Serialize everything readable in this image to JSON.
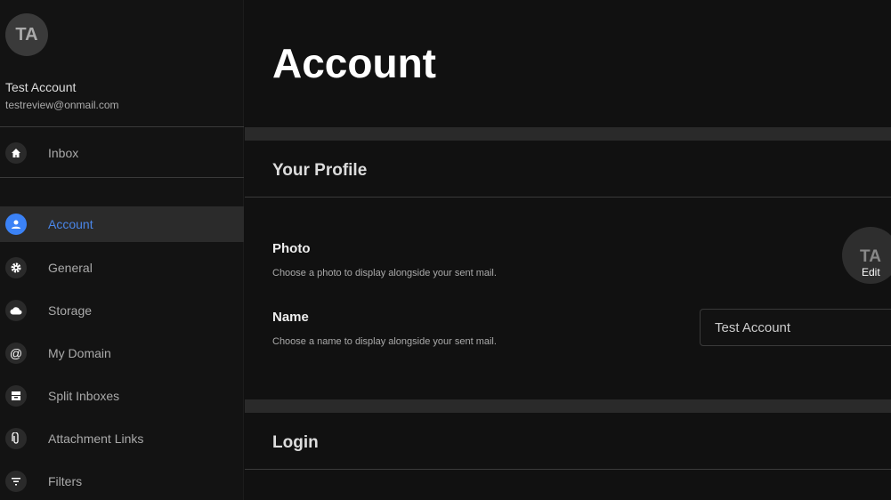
{
  "user": {
    "initials": "TA",
    "name": "Test Account",
    "email": "testreview@onmail.com"
  },
  "sidebar": {
    "items": [
      {
        "label": "Inbox",
        "icon": "home-icon"
      },
      {
        "label": "Account",
        "icon": "person-icon",
        "active": true
      },
      {
        "label": "General",
        "icon": "gear-icon"
      },
      {
        "label": "Storage",
        "icon": "cloud-icon"
      },
      {
        "label": "My Domain",
        "icon": "at-icon"
      },
      {
        "label": "Split Inboxes",
        "icon": "tray-icon"
      },
      {
        "label": "Attachment Links",
        "icon": "paperclip-icon"
      },
      {
        "label": "Filters",
        "icon": "filter-icon"
      }
    ]
  },
  "main": {
    "title": "Account",
    "profile": {
      "heading": "Your Profile",
      "photo": {
        "label": "Photo",
        "desc": "Choose a photo to display alongside your sent mail.",
        "avatar_initials": "TA",
        "edit_label": "Edit"
      },
      "name": {
        "label": "Name",
        "desc": "Choose a name to display alongside your sent mail.",
        "value": "Test Account"
      }
    },
    "login": {
      "heading": "Login"
    }
  },
  "colors": {
    "accent": "#3b82f6",
    "background": "#111111"
  }
}
